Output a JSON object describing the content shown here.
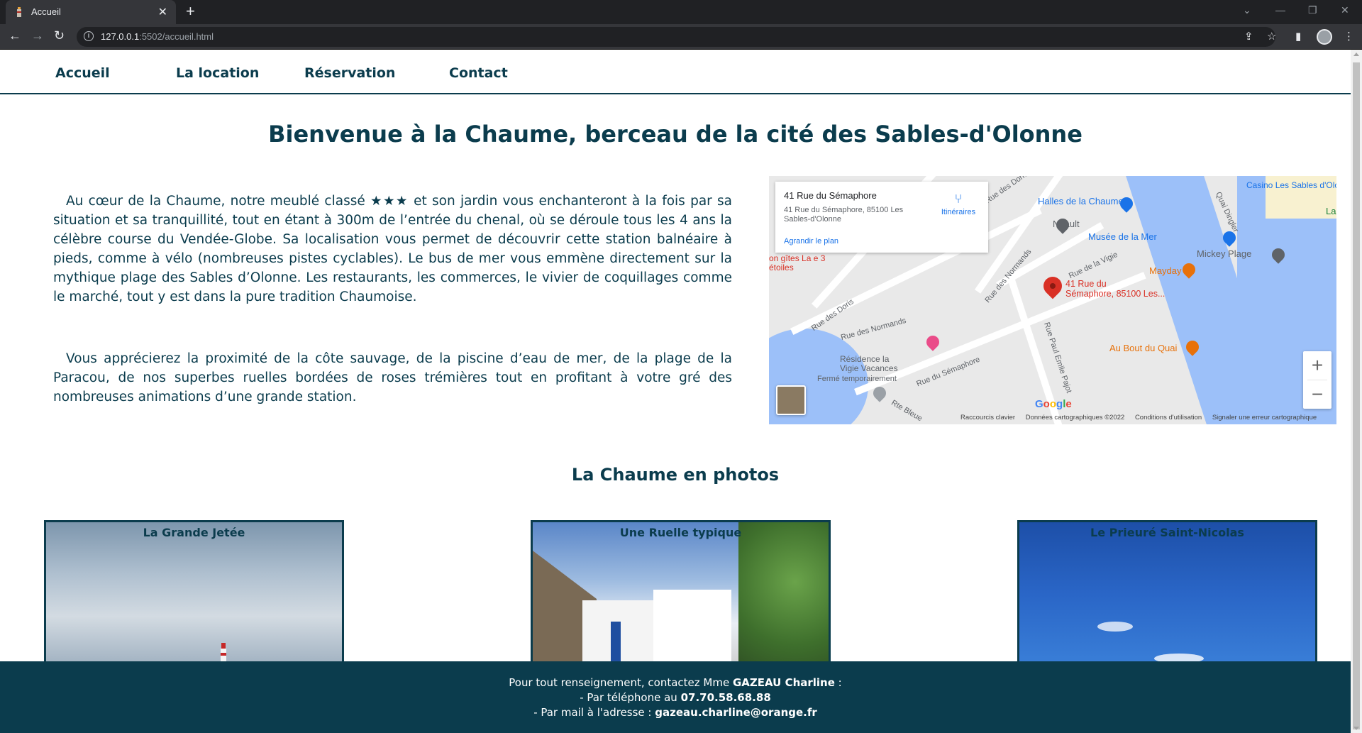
{
  "browser": {
    "tab_title": "Accueil",
    "url_host": "127.0.0.1",
    "url_rest": ":5502/accueil.html"
  },
  "nav": {
    "items": [
      "Accueil",
      "La location",
      "Réservation",
      "Contact"
    ]
  },
  "main": {
    "title": "Bienvenue à la Chaume, berceau de la cité des Sables-d'Olonne",
    "paragraph1": "Au cœur de la Chaume, notre meublé classé ★★★ et son jardin vous enchanteront à la fois par sa situation et sa tranquillité, tout en étant à 300m de l’entrée du chenal, où se déroule tous les 4 ans la célèbre course du Vendée-Globe. Sa localisation vous permet de découvrir cette station balnéaire à pieds, comme à vélo (nombreuses pistes cyclables). Le bus de mer vous emmène directement sur la mythique plage des Sables d’Olonne. Les restaurants, les commerces, le vivier de coquillages comme le marché, tout y est dans la pure tradition Chaumoise.",
    "paragraph2": "Vous apprécierez la proximité de la côte sauvage, de la piscine d’eau de mer, de la plage de la Paracou, de nos superbes ruelles bordées de roses trémières tout en profitant à votre gré des nombreuses animations d’une grande station."
  },
  "map": {
    "card_title": "41 Rue du Sémaphore",
    "card_address": "41 Rue du Sémaphore, 85100 Les Sables-d'Olonne",
    "card_link": "Agrandir le plan",
    "directions": "Itinéraires",
    "pin_label_1": "41 Rue du",
    "pin_label_2": "Sémaphore, 85100 Les...",
    "labels": {
      "casino": "Casino Les Sables d'Olonne",
      "halles": "Halles de la Chaume",
      "neault": "Neault",
      "musee": "Musée de la Mer",
      "mayday": "Mayday",
      "mickey": "Mickey Plage",
      "aubout": "Au Bout du Quai",
      "residence": "Résidence la Vigie Vacances",
      "ferme": "Fermé temporairement",
      "gites": "on gîtes La e 3 étoiles",
      "rue_vigie": "Rue de la Vigie",
      "rue_normands": "Rue des Normands",
      "rue_normands2": "Rue des Normands",
      "rue_dorrs": "Rue des Dorrs",
      "rue_semaphore": "Rue du Sémaphore",
      "rue_emile": "Rue Paul Emile Pajot",
      "rte_bleue": "Rte Bleue",
      "quai_dingler": "Quai Dingler",
      "rue_doris": "Rue des Doris",
      "la": "La"
    },
    "google": "Google",
    "attribution": [
      "Raccourcis clavier",
      "Données cartographiques ©2022",
      "Conditions d'utilisation",
      "Signaler une erreur cartographique"
    ]
  },
  "photos": {
    "title": "La Chaume en photos",
    "items": [
      "La Grande Jetée",
      "Une Ruelle typique",
      "Le Prieuré Saint-Nicolas"
    ]
  },
  "footer": {
    "line1_pre": "Pour tout renseignement, contactez Mme ",
    "name": "GAZEAU Charline",
    "line1_post": " :",
    "line2_pre": "- Par téléphone au ",
    "phone": "07.70.58.68.88",
    "line3_pre": "- Par mail à l'adresse : ",
    "email": "gazeau.charline@orange.fr"
  },
  "colors": {
    "primary": "#0b3c4d"
  }
}
